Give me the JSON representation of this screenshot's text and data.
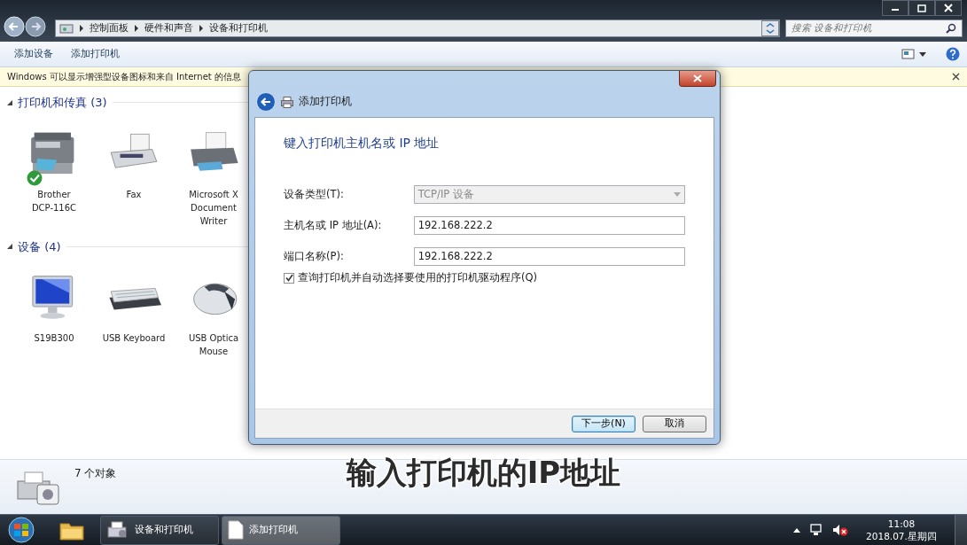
{
  "explorer": {
    "breadcrumb": [
      "控制面板",
      "硬件和声音",
      "设备和打印机"
    ],
    "search": {
      "placeholder": "搜索 设备和打印机"
    },
    "toolbar": [
      "添加设备",
      "添加打印机"
    ],
    "info_bar": "Windows 可以显示增强型设备图标和来自 Internet 的信息",
    "groups": [
      {
        "title": "打印机和传真 (3)",
        "items": [
          {
            "kind": "mfp",
            "lines": [
              "Brother",
              "DCP-116C"
            ],
            "default": true
          },
          {
            "kind": "fax",
            "lines": [
              "Fax"
            ],
            "default": false
          },
          {
            "kind": "printer",
            "lines": [
              "Microsoft X",
              "Document",
              "Writer"
            ],
            "default": false
          }
        ]
      },
      {
        "title": "设备 (4)",
        "items": [
          {
            "kind": "monitor",
            "lines": [
              "S19B300"
            ],
            "default": false
          },
          {
            "kind": "keyboard",
            "lines": [
              "USB Keyboard"
            ],
            "default": false
          },
          {
            "kind": "mouse",
            "lines": [
              "USB Optica",
              "Mouse"
            ],
            "default": false
          }
        ]
      }
    ],
    "details": {
      "count": "7 个对象"
    }
  },
  "dialog": {
    "nav_title": "添加打印机",
    "heading": "键入打印机主机名或 IP 地址",
    "fields": [
      {
        "kind": "select",
        "label": "设备类型(T):",
        "value": "TCP/IP 设备",
        "disabled": true
      },
      {
        "kind": "text",
        "label": "主机名或 IP 地址(A):",
        "value": "192.168.222.2",
        "disabled": false
      },
      {
        "kind": "text",
        "label": "端口名称(P):",
        "value": "192.168.222.2",
        "disabled": false
      }
    ],
    "checkbox": {
      "label": "查询打印机并自动选择要使用的打印机驱动程序(Q)",
      "checked": true
    },
    "buttons": [
      {
        "label": "下一步(N)",
        "default": true
      },
      {
        "label": "取消",
        "default": false
      }
    ]
  },
  "caption": "输入打印机的IP地址",
  "taskbar": {
    "items": [
      {
        "kind": "devices",
        "label": "设备和打印机",
        "selected": false
      },
      {
        "kind": "document",
        "label": "添加打印机",
        "selected": true
      }
    ],
    "time": "11:08",
    "date": "2018.07.星期四"
  }
}
